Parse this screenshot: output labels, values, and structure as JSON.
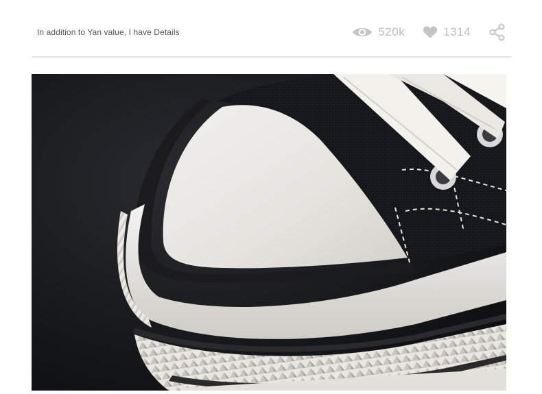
{
  "post": {
    "caption": "In addition to Yan value, I have Details",
    "views": "520k",
    "likes": "1314"
  },
  "icons": {
    "views": "eye-icon",
    "likes": "heart-icon",
    "share": "share-icon"
  },
  "colors": {
    "stat_gray": "#bdbdbd",
    "divider": "#e6e6e6"
  }
}
